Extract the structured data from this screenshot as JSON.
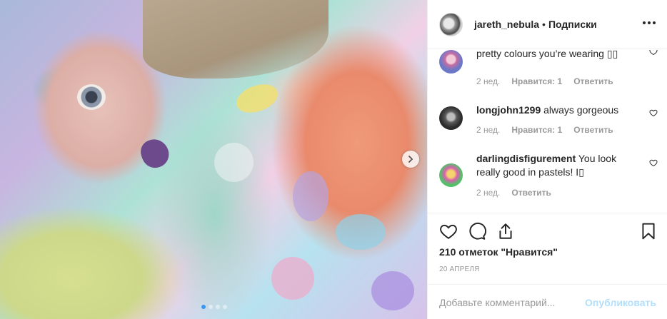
{
  "post": {
    "username": "jareth_nebula",
    "separator": "•",
    "follow_label": "Подписки",
    "carousel": {
      "total_slides": 4,
      "active_slide": 1
    }
  },
  "comments": [
    {
      "username": "",
      "text": "pretty colours you’re wearing ▯▯",
      "age": "2 нед.",
      "likes_label": "Нравится: 1",
      "reply_label": "Ответить",
      "avatar_color": "#c86da3"
    },
    {
      "username": "longjohn1299",
      "text": "always gorgeous",
      "age": "2 нед.",
      "likes_label": "Нравится: 1",
      "reply_label": "Ответить",
      "avatar_color": "#3a3a3a"
    },
    {
      "username": "darlingdisfigurement",
      "text": "You look really good in pastels! I▯",
      "age": "2 нед.",
      "likes_label": "",
      "reply_label": "Ответить",
      "avatar_color": "#d95fb0"
    }
  ],
  "engagement": {
    "likes_text": "210 отметок \"Нравится\"",
    "date_text": "20 АПРЕЛЯ"
  },
  "comment_box": {
    "placeholder": "Добавьте комментарий...",
    "post_label": "Опубликовать"
  },
  "icons": [
    "more-icon",
    "heart-icon",
    "comment-icon",
    "share-icon",
    "bookmark-icon",
    "chevron-right-icon"
  ],
  "colors": {
    "link_blue": "#3897f0",
    "post_button_disabled": "#b2dffc",
    "meta_gray": "#999999",
    "text": "#262626"
  }
}
